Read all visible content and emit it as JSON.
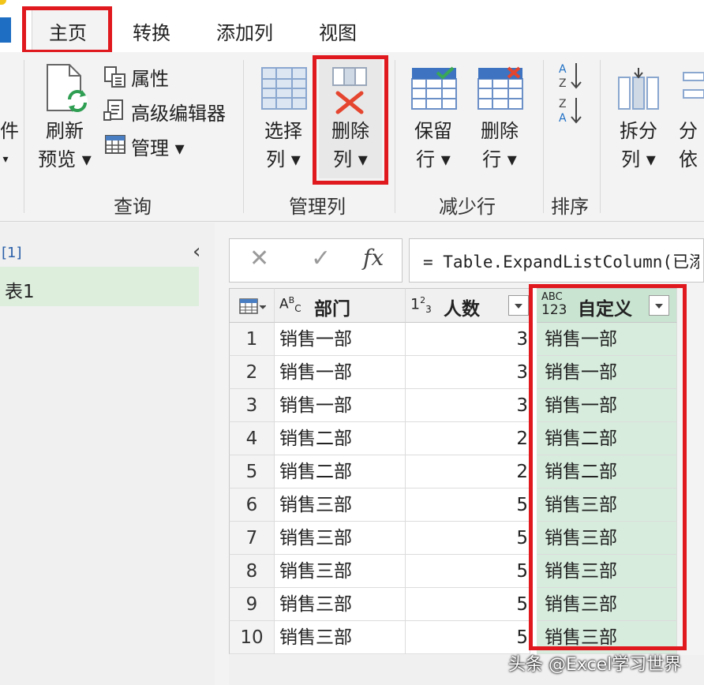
{
  "tabs": [
    {
      "label": "主页",
      "active": true
    },
    {
      "label": "转换",
      "active": false
    },
    {
      "label": "添加列",
      "active": false
    },
    {
      "label": "视图",
      "active": false
    }
  ],
  "ribbon": {
    "left_cut": {
      "line1": "件",
      "line2": "▾"
    },
    "refresh": {
      "line1": "刷新",
      "line2": "预览 ▾"
    },
    "properties": "属性",
    "advanced_editor": "高级编辑器",
    "manage": "管理 ▾",
    "query_group": "查询",
    "choose_columns": {
      "line1": "选择",
      "line2": "列 ▾"
    },
    "remove_columns": {
      "line1": "删除",
      "line2": "列 ▾"
    },
    "manage_columns_group": "管理列",
    "keep_rows": {
      "line1": "保留",
      "line2": "行 ▾"
    },
    "remove_rows": {
      "line1": "删除",
      "line2": "行 ▾"
    },
    "reduce_rows_group": "减少行",
    "sort_group": "排序",
    "split_column": {
      "line1": "拆分",
      "line2": "列 ▾"
    },
    "group_by": {
      "line1": "分",
      "line2": "依"
    }
  },
  "left_pane": {
    "header": "[1]",
    "query_name": "表1"
  },
  "formula_bar": {
    "cancel_glyph": "✕",
    "confirm_glyph": "✓",
    "fx_label": "fx",
    "formula": "= Table.ExpandListColumn(已添"
  },
  "table": {
    "columns": [
      {
        "type_icon": "ABC",
        "name": "部门"
      },
      {
        "type_icon": "123",
        "name": "人数"
      },
      {
        "type_icon": "ABC123",
        "name": "自定义"
      }
    ],
    "rows": [
      {
        "n": "1",
        "dept": "销售一部",
        "count": "3",
        "custom": "销售一部"
      },
      {
        "n": "2",
        "dept": "销售一部",
        "count": "3",
        "custom": "销售一部"
      },
      {
        "n": "3",
        "dept": "销售一部",
        "count": "3",
        "custom": "销售一部"
      },
      {
        "n": "4",
        "dept": "销售二部",
        "count": "2",
        "custom": "销售二部"
      },
      {
        "n": "5",
        "dept": "销售二部",
        "count": "2",
        "custom": "销售二部"
      },
      {
        "n": "6",
        "dept": "销售三部",
        "count": "5",
        "custom": "销售三部"
      },
      {
        "n": "7",
        "dept": "销售三部",
        "count": "5",
        "custom": "销售三部"
      },
      {
        "n": "8",
        "dept": "销售三部",
        "count": "5",
        "custom": "销售三部"
      },
      {
        "n": "9",
        "dept": "销售三部",
        "count": "5",
        "custom": "销售三部"
      },
      {
        "n": "10",
        "dept": "销售三部",
        "count": "5",
        "custom": "销售三部"
      }
    ]
  },
  "watermark": "头条 @Excel学习世界",
  "colors": {
    "highlight_red": "#e0191f",
    "selected_column": "#d7ecdd",
    "accent_blue": "#1e6fc4"
  }
}
